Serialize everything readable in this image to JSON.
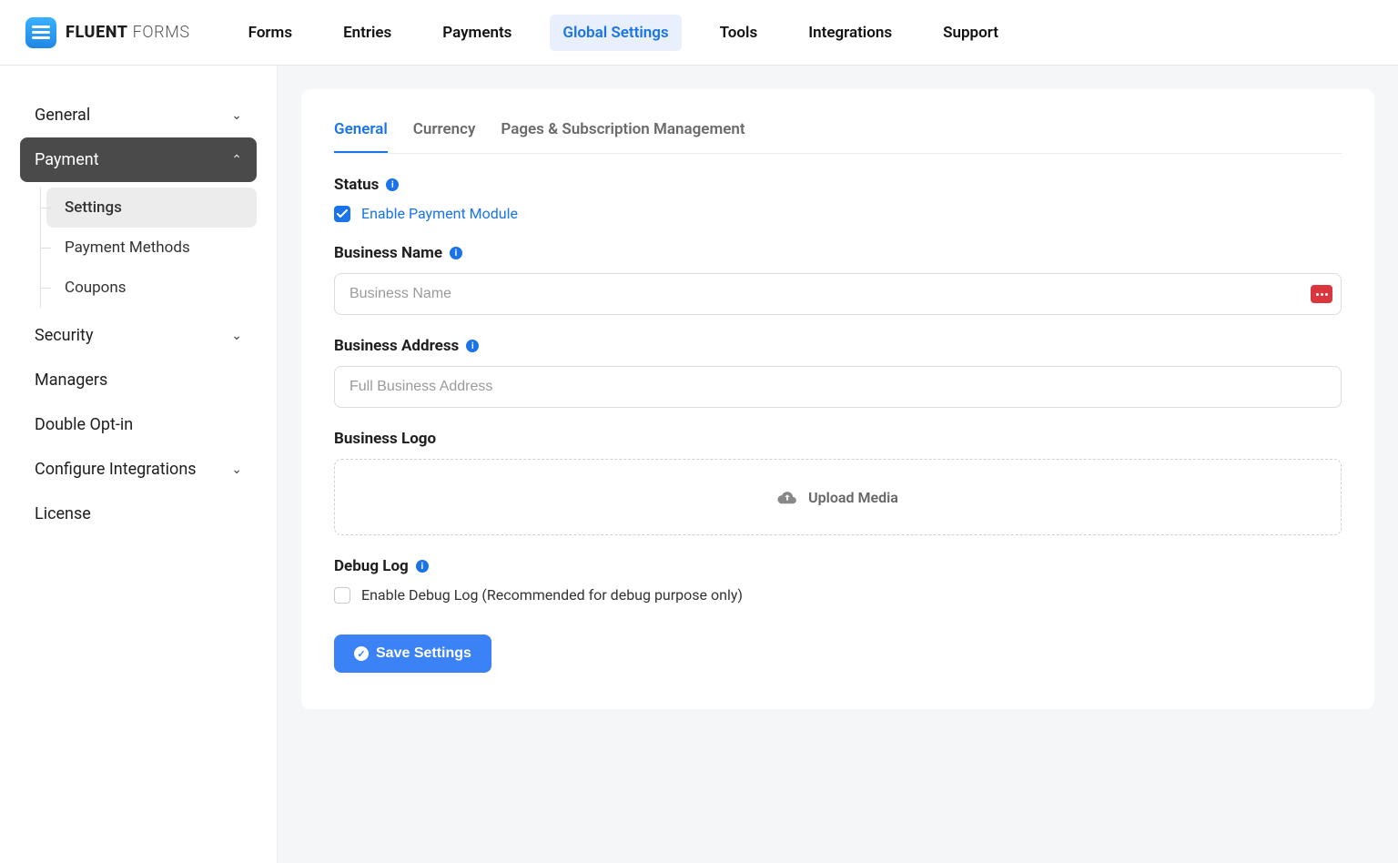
{
  "brand": {
    "bold": "FLUENT",
    "thin": " FORMS"
  },
  "nav": {
    "items": [
      "Forms",
      "Entries",
      "Payments",
      "Global Settings",
      "Tools",
      "Integrations",
      "Support"
    ],
    "activeIndex": 3
  },
  "sidebar": {
    "general": "General",
    "payment": "Payment",
    "payment_sub": [
      "Settings",
      "Payment Methods",
      "Coupons"
    ],
    "security": "Security",
    "managers": "Managers",
    "double_optin": "Double Opt-in",
    "configure_integrations": "Configure Integrations",
    "license": "License"
  },
  "tabs": {
    "items": [
      "General",
      "Currency",
      "Pages & Subscription Management"
    ],
    "activeIndex": 0
  },
  "form": {
    "status": {
      "label": "Status",
      "checkbox_label": "Enable Payment Module",
      "checked": true
    },
    "business_name": {
      "label": "Business Name",
      "placeholder": "Business Name",
      "value": ""
    },
    "business_address": {
      "label": "Business Address",
      "placeholder": "Full Business Address",
      "value": ""
    },
    "business_logo": {
      "label": "Business Logo",
      "upload_text": "Upload Media"
    },
    "debug_log": {
      "label": "Debug Log",
      "checkbox_label": "Enable Debug Log (Recommended for debug purpose only)",
      "checked": false
    },
    "save_button": "Save Settings"
  }
}
